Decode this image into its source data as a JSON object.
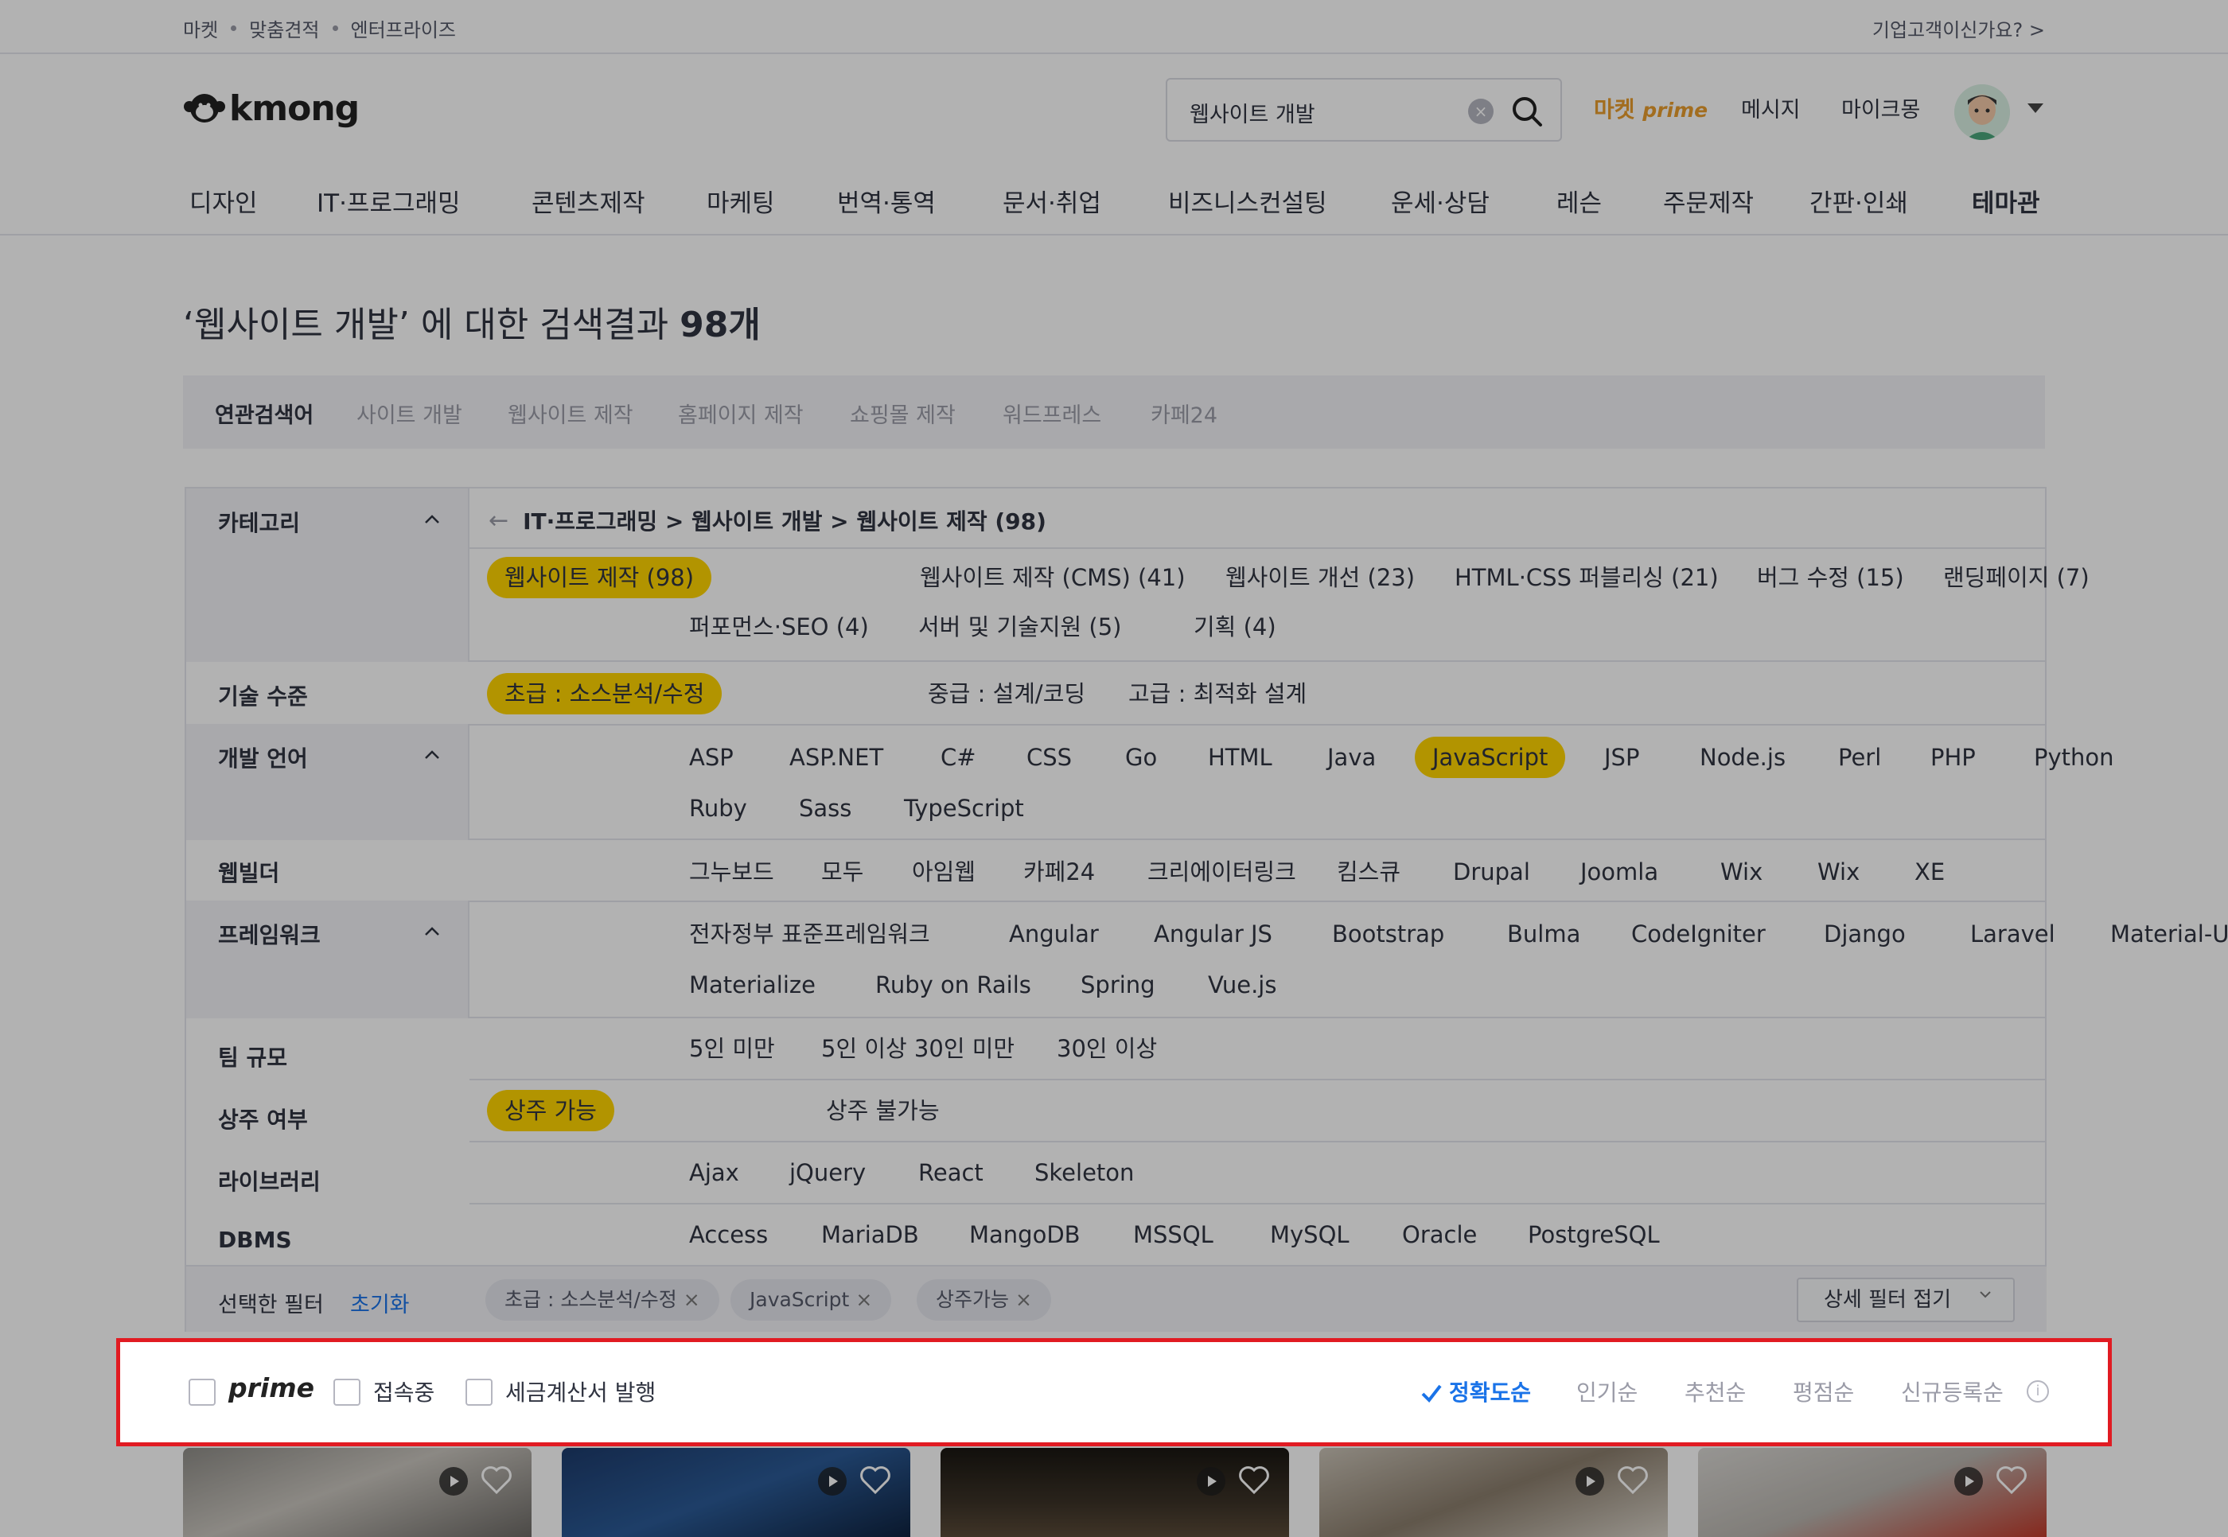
{
  "topbar": {
    "links": [
      "마켓",
      "맞춤견적",
      "엔터프라이즈"
    ],
    "biz": "기업고객이신가요? >"
  },
  "header": {
    "logo": "kmong",
    "search_value": "웹사이트 개발",
    "clear_glyph": "×",
    "prime_label": "마켓",
    "prime_suffix": "prime",
    "message": "메시지",
    "mykmong": "마이크몽"
  },
  "categories": [
    "디자인",
    "IT·프로그래밍",
    "콘텐츠제작",
    "마케팅",
    "번역·통역",
    "문서·취업",
    "비즈니스컨설팅",
    "운세·상담",
    "레슨",
    "주문제작",
    "간판·인쇄",
    "테마관"
  ],
  "results": {
    "query": "‘웹사이트 개발’",
    "middle": " 에 대한 검색결과 ",
    "count": "98개"
  },
  "related": {
    "label": "연관검색어",
    "keywords": [
      "사이트 개발",
      "웹사이트 제작",
      "홈페이지 제작",
      "쇼핑몰 제작",
      "워드프레스",
      "카페24"
    ]
  },
  "filters": {
    "back_glyph": "←",
    "breadcrumb": "IT·프로그래밍 > 웹사이트 개발 > 웹사이트 제작 (98)",
    "sections": {
      "category": "카테고리",
      "level": "기술 수준",
      "language": "개발 언어",
      "webbuilder": "웹빌더",
      "framework": "프레임워크",
      "team": "팀 규모",
      "resident": "상주 여부",
      "library": "라이브러리",
      "dbms": "DBMS"
    },
    "category_chips": [
      "웹사이트 제작 (98)",
      "웹사이트 제작 (CMS) (41)",
      "웹사이트 개선 (23)",
      "HTML·CSS 퍼블리싱 (21)",
      "버그 수정 (15)",
      "랜딩페이지 (7)",
      "퍼포먼스·SEO (4)",
      "서버 및 기술지원 (5)",
      "기획 (4)"
    ],
    "level_chips": [
      "초급 : 소스분석/수정",
      "중급 : 설계/코딩",
      "고급 : 최적화 설계"
    ],
    "language_chips": [
      "ASP",
      "ASP.NET",
      "C#",
      "CSS",
      "Go",
      "HTML",
      "Java",
      "JavaScript",
      "JSP",
      "Node.js",
      "Perl",
      "PHP",
      "Python",
      "Ruby",
      "Sass",
      "TypeScript"
    ],
    "webbuilder_chips": [
      "그누보드",
      "모두",
      "아임웹",
      "카페24",
      "크리에이터링크",
      "킴스큐",
      "Drupal",
      "Joomla",
      "Wix",
      "Wix",
      "XE"
    ],
    "framework_chips": [
      "전자정부 표준프레임워크",
      "Angular",
      "Angular JS",
      "Bootstrap",
      "Bulma",
      "CodeIgniter",
      "Django",
      "Laravel",
      "Material-UI",
      "Materialize",
      "Ruby on Rails",
      "Spring",
      "Vue.js"
    ],
    "team_chips": [
      "5인 미만",
      "5인 이상 30인 미만",
      "30인 이상"
    ],
    "resident_chips": [
      "상주 가능",
      "상주 불가능"
    ],
    "library_chips": [
      "Ajax",
      "jQuery",
      "React",
      "Skeleton"
    ],
    "dbms_chips": [
      "Access",
      "MariaDB",
      "MangoDB",
      "MSSQL",
      "MySQL",
      "Oracle",
      "PostgreSQL"
    ],
    "selected_label": "선택한 필터",
    "reset": "초기화",
    "remove_glyph": "×",
    "selected_tags": [
      "초급 : 소스분석/수정",
      "JavaScript",
      "상주가능"
    ],
    "detail_toggle": "상세 필터 접기"
  },
  "sortbar": {
    "prime": "prime",
    "online": "접속중",
    "tax": "세금계산서 발행",
    "sorts": [
      "정확도순",
      "인기순",
      "추천순",
      "평점순",
      "신규등록순"
    ],
    "active_sort": "정확도순",
    "info_glyph": "i"
  },
  "colors": {
    "accent_yellow": "#ffd400",
    "link_blue": "#1a73e8",
    "highlight_red": "#e11b22",
    "prime_orange": "#e89c2d"
  }
}
